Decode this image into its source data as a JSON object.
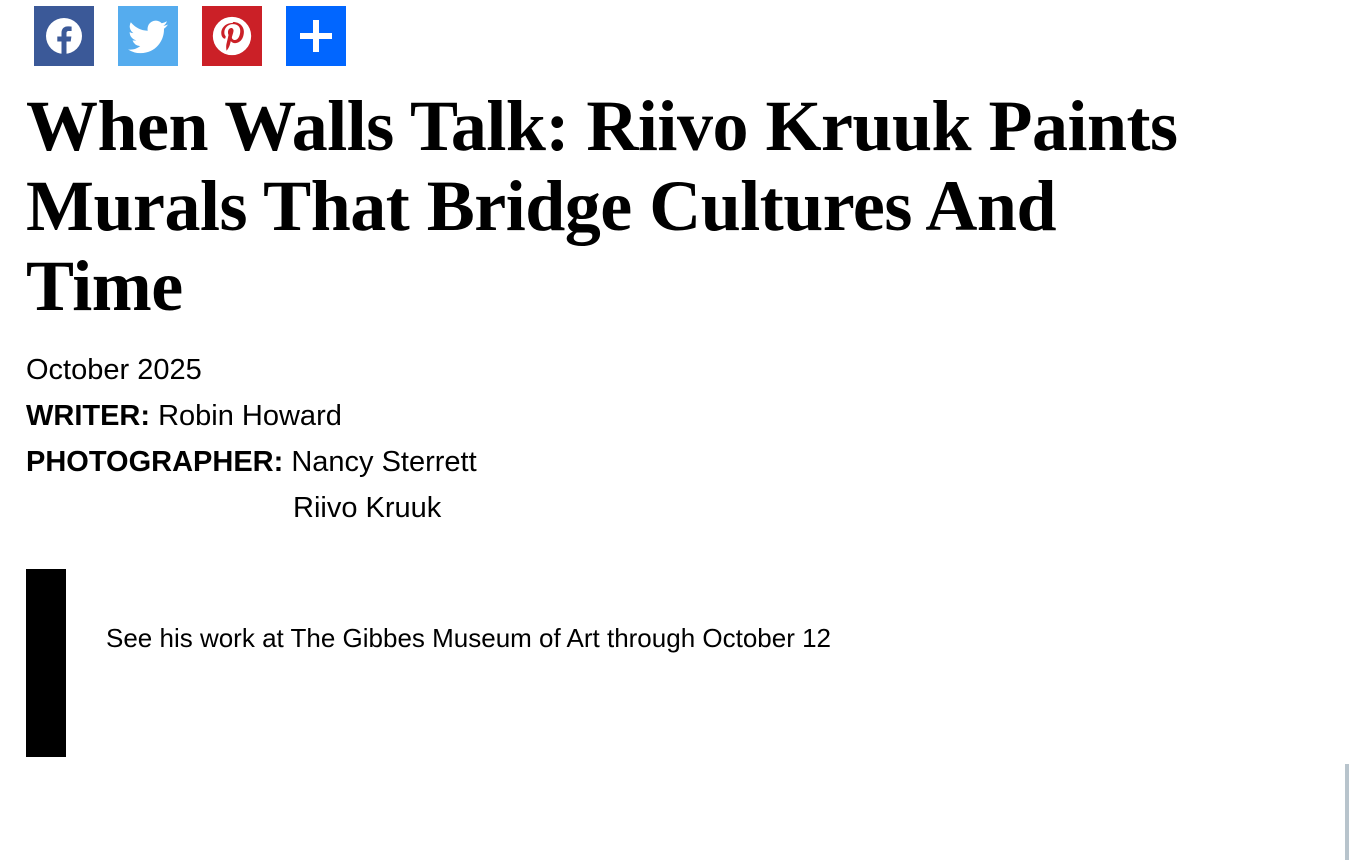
{
  "share": {
    "buttons": [
      {
        "network": "facebook",
        "icon": "facebook-icon",
        "color": "#3b5998"
      },
      {
        "network": "twitter",
        "icon": "twitter-icon",
        "color": "#55acee"
      },
      {
        "network": "pinterest",
        "icon": "pinterest-icon",
        "color": "#cb2027"
      },
      {
        "network": "more",
        "icon": "plus-icon",
        "color": "#0166ff"
      }
    ]
  },
  "article": {
    "title_lines": [
      "When Walls Talk: Riivo Kruuk Paints",
      "Murals That Bridge Cultures And",
      "Time"
    ],
    "date": "October 2025",
    "writer_label": "WRITER:",
    "writer": "Robin Howard",
    "photographer_label": "PHOTOGRAPHER:",
    "photographers": [
      "Nancy Sterrett",
      "Riivo Kruuk"
    ],
    "callout": "See his work at The Gibbes Museum of Art through October 12"
  }
}
